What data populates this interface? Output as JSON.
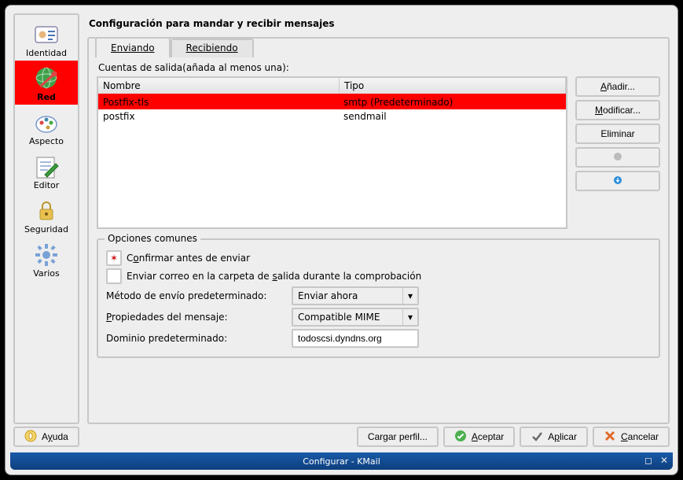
{
  "window": {
    "title": "Configurar - KMail"
  },
  "page_title": "Configuración para mandar y recibir mensajes",
  "sidebar": {
    "items": [
      {
        "label": "Identidad"
      },
      {
        "label": "Red"
      },
      {
        "label": "Aspecto"
      },
      {
        "label": "Editor"
      },
      {
        "label": "Seguridad"
      },
      {
        "label": "Varios"
      }
    ]
  },
  "tabs": {
    "send": "Enviando",
    "recv": "Recibiendo"
  },
  "accounts": {
    "label": "Cuentas de salida(añada al menos una):",
    "cols": {
      "name": "Nombre",
      "type": "Tipo"
    },
    "rows": [
      {
        "name": "Postfix-tls",
        "type": "smtp (Predeterminado)",
        "selected": true
      },
      {
        "name": "postfix",
        "type": "sendmail",
        "selected": false
      }
    ]
  },
  "buttons": {
    "add": "Añadir...",
    "mod": "Modificar...",
    "del": "Eliminar"
  },
  "options": {
    "legend": "Opciones comunes",
    "confirm": "Confirmar antes de enviar",
    "send_check": "Enviar correo en la carpeta de salida durante la comprobación",
    "method_lbl": "Método de envío predeterminado:",
    "method_val": "Enviar ahora",
    "props_lbl": "Propiedades del mensaje:",
    "props_val": "Compatible MIME",
    "domain_lbl": "Dominio predeterminado:",
    "domain_val": "todoscsi.dyndns.org"
  },
  "footer": {
    "help": "Ayuda",
    "load": "Cargar perfil...",
    "ok": "Aceptar",
    "apply": "Aplicar",
    "cancel": "Cancelar"
  }
}
